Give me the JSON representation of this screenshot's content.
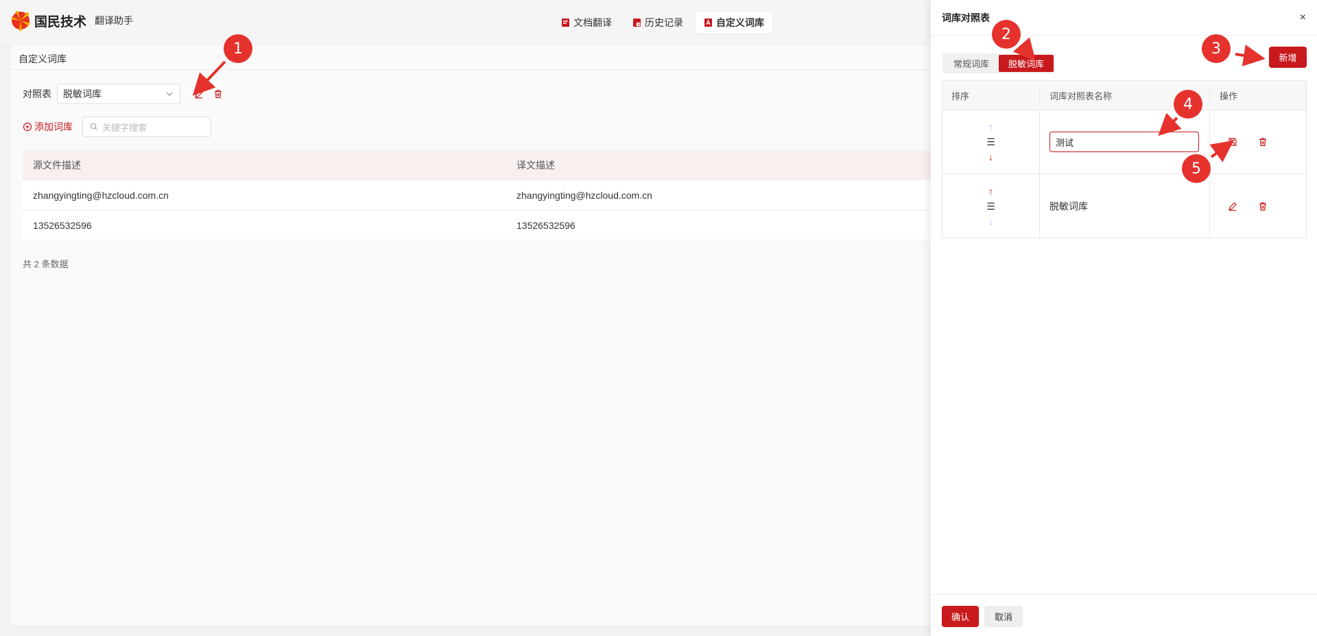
{
  "header": {
    "brand": "国民技术",
    "subtitle": "翻译助手",
    "nav": [
      {
        "label": "文档翻译"
      },
      {
        "label": "历史记录"
      },
      {
        "label": "自定义词库"
      }
    ]
  },
  "main": {
    "title": "自定义词库",
    "compare_label": "对照表",
    "compare_value": "脱敏词库",
    "add_label": "添加词库",
    "search_placeholder": "关键字搜索",
    "columns": [
      "源文件描述",
      "译文描述"
    ],
    "rows": [
      [
        "zhangyingting@hzcloud.com.cn",
        "zhangyingting@hzcloud.com.cn"
      ],
      [
        "13526532596",
        "13526532596"
      ]
    ],
    "total": "共 2 条数据"
  },
  "drawer": {
    "title": "词库对照表",
    "close": "×",
    "tabs": [
      "常规词库",
      "脱敏词库"
    ],
    "add_button": "新增",
    "columns": [
      "排序",
      "词库对照表名称",
      "操作"
    ],
    "rows": [
      {
        "name": "测试",
        "editing": true
      },
      {
        "name": "脱敏词库",
        "editing": false
      }
    ],
    "sort_glyphs": {
      "up": "↑",
      "handle": "☰",
      "down": "↓"
    },
    "confirm": "确认",
    "cancel": "取消"
  },
  "annotations": [
    "1",
    "2",
    "3",
    "4",
    "5"
  ],
  "colors": {
    "accent": "#c8191c",
    "marker": "#e5322d"
  }
}
